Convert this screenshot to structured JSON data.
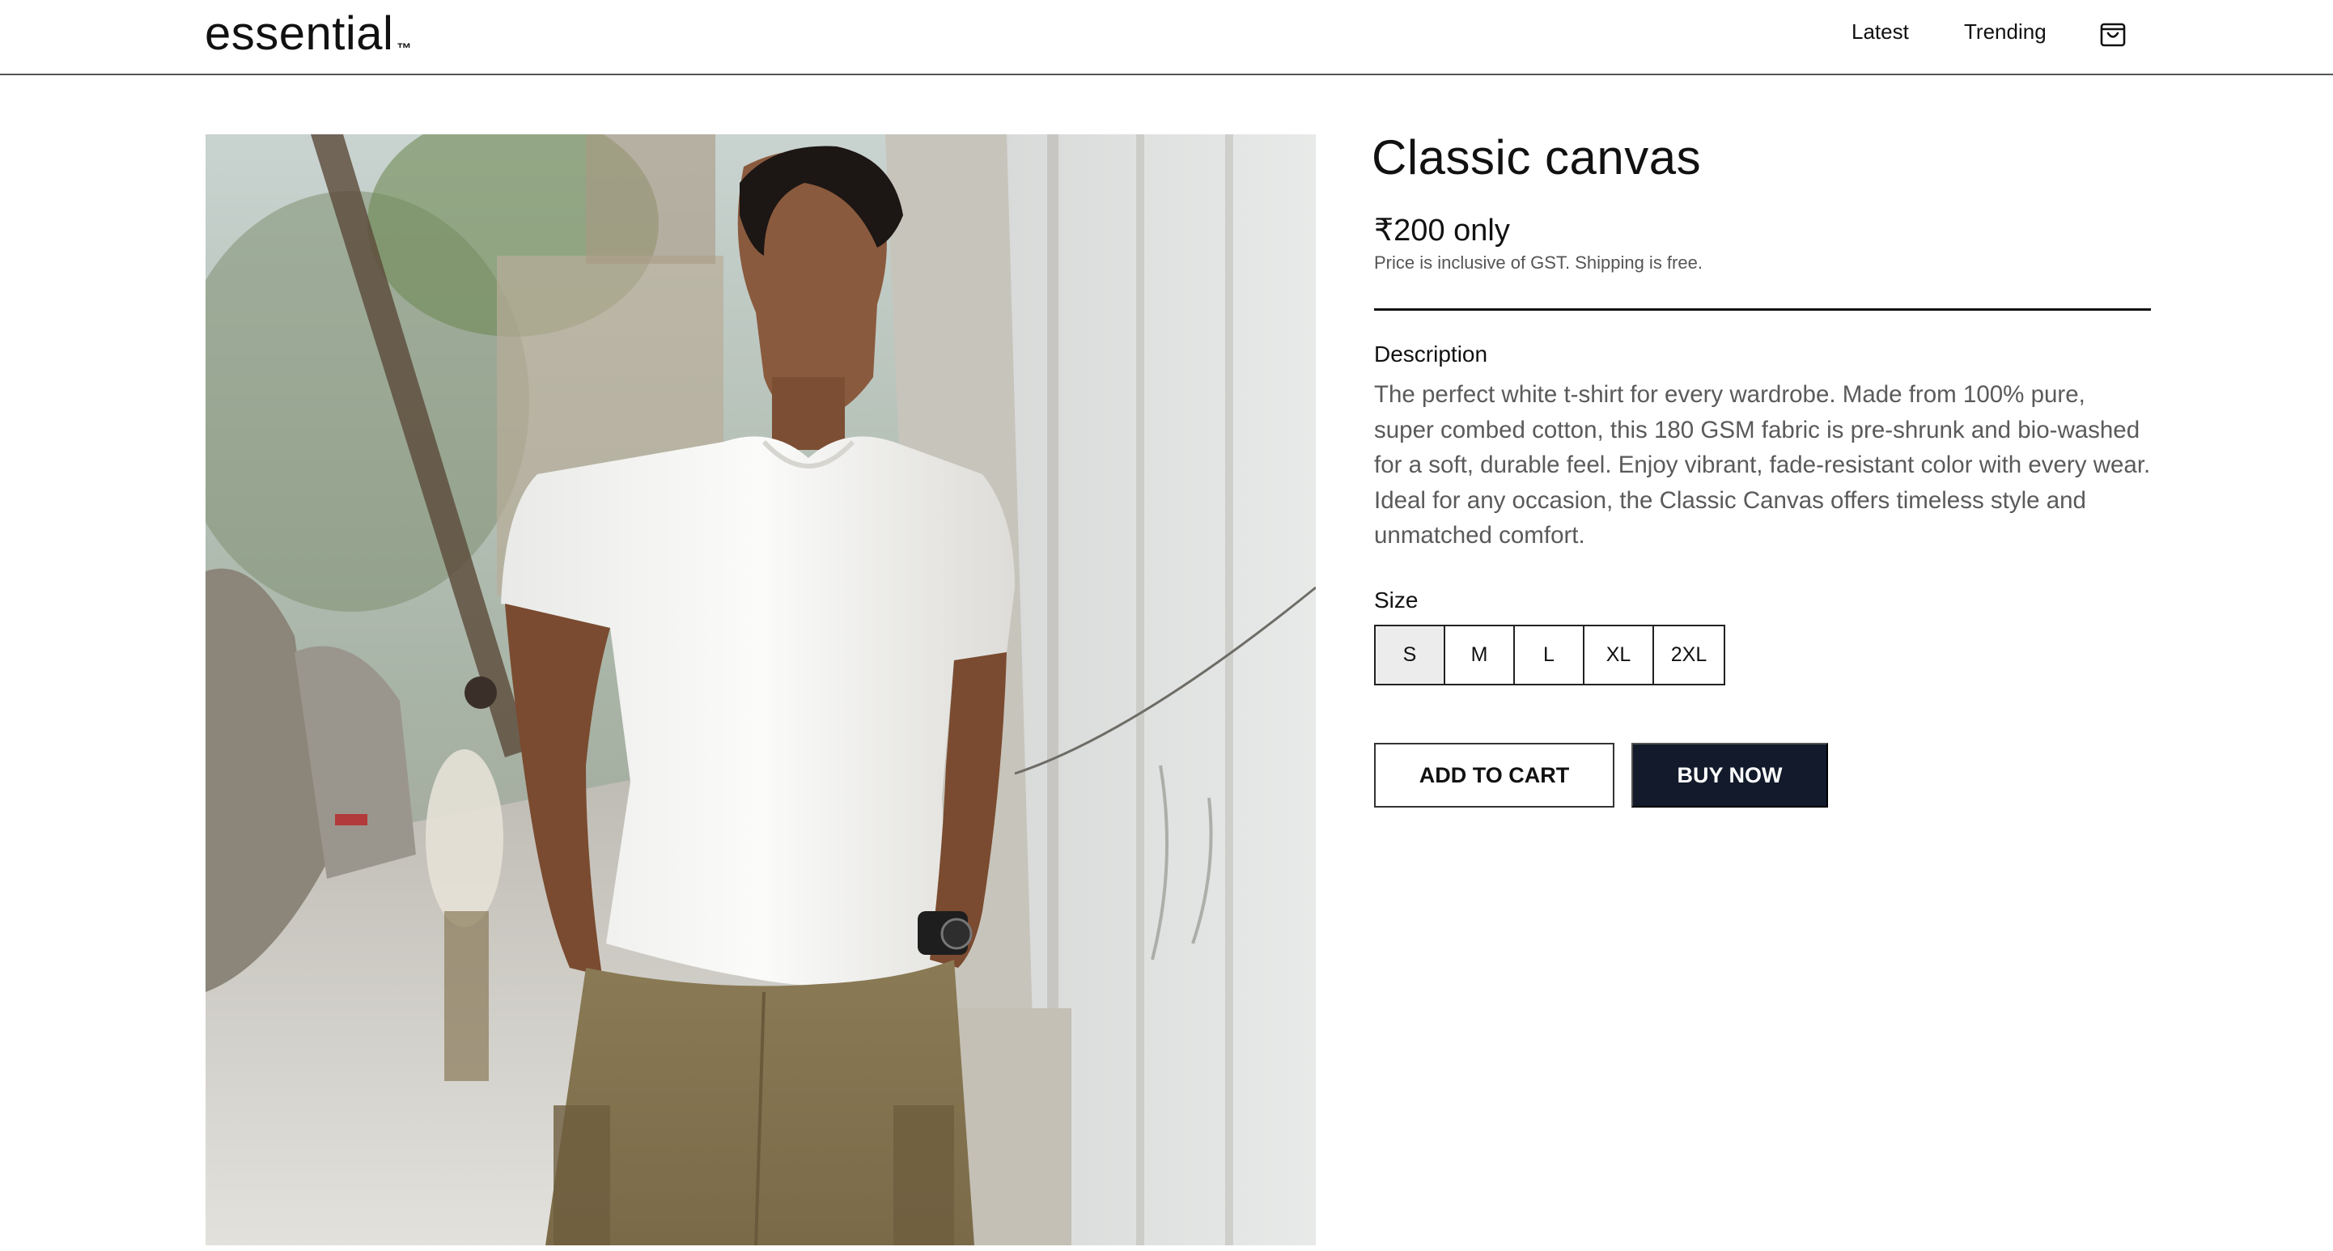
{
  "header": {
    "logo": "essential",
    "logo_mark": "™",
    "nav": [
      {
        "label": "Latest"
      },
      {
        "label": "Trending"
      }
    ],
    "cart_icon": "shopping-bag-icon"
  },
  "product": {
    "image_alt": "Man wearing a plain white t-shirt and khaki cargo pants standing beside a white wall on a city street",
    "title": "Classic canvas",
    "price": "₹200 only",
    "price_note": "Price is inclusive of GST. Shipping is free.",
    "description_label": "Description",
    "description": "The perfect white t-shirt for every wardrobe. Made from 100% pure, super combed cotton, this 180 GSM fabric is pre-shrunk and bio-washed for a soft, durable feel. Enjoy vibrant, fade-resistant color with every wear. Ideal for any occasion, the Classic Canvas offers timeless style and unmatched comfort.",
    "size_label": "Size",
    "sizes": [
      "S",
      "M",
      "L",
      "XL",
      "2XL"
    ],
    "selected_size": "S",
    "add_to_cart_label": "ADD TO CART",
    "buy_now_label": "BUY NOW"
  },
  "colors": {
    "buy_now_bg": "#121a2b",
    "selected_size_bg": "#ececec"
  }
}
